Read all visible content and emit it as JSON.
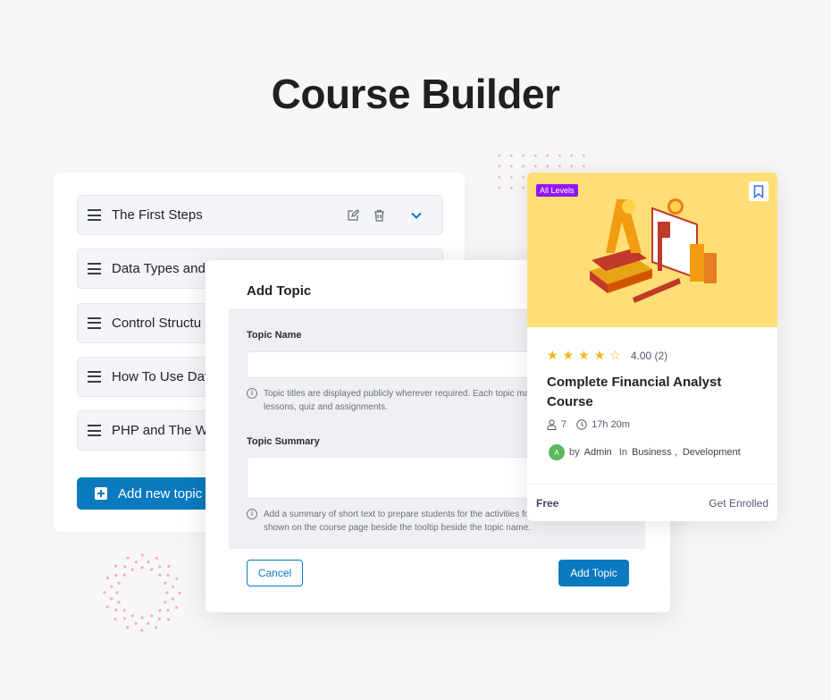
{
  "page_title": "Course Builder",
  "topics": [
    {
      "label": "The First Steps"
    },
    {
      "label": "Data Types and"
    },
    {
      "label": "Control Structu"
    },
    {
      "label": "How To Use Dat"
    },
    {
      "label": "PHP and The W"
    }
  ],
  "add_topic_button": "Add new topic",
  "modal": {
    "title": "Add Topic",
    "name_label": "Topic Name",
    "name_value": "",
    "name_hint": "Topic titles are displayed publicly wherever required. Each topic may contain one or more lessons, quiz and assignments.",
    "summary_label": "Topic Summary",
    "summary_value": "",
    "summary_hint": "Add a summary of short text to prepare students for the activities for the topic. The text is shown on the course page beside the tooltip beside the topic name.",
    "cancel": "Cancel",
    "submit": "Add Topic"
  },
  "card": {
    "level_badge": "All Levels",
    "rating": 4,
    "rating_max": 5,
    "rating_text": "4.00 (2)",
    "title": "Complete Financial Analyst Course",
    "students": "7",
    "duration": "17h 20m",
    "avatar_letter": "A",
    "by": "by",
    "author": "Admin",
    "in": "In",
    "categories": "Business ,  Development",
    "price": "Free",
    "enroll": "Get Enrolled"
  },
  "colors": {
    "primary": "#0a7abf",
    "badge": "#9317f5",
    "card_image": "#ffdf75",
    "star": "#f5b50a"
  }
}
